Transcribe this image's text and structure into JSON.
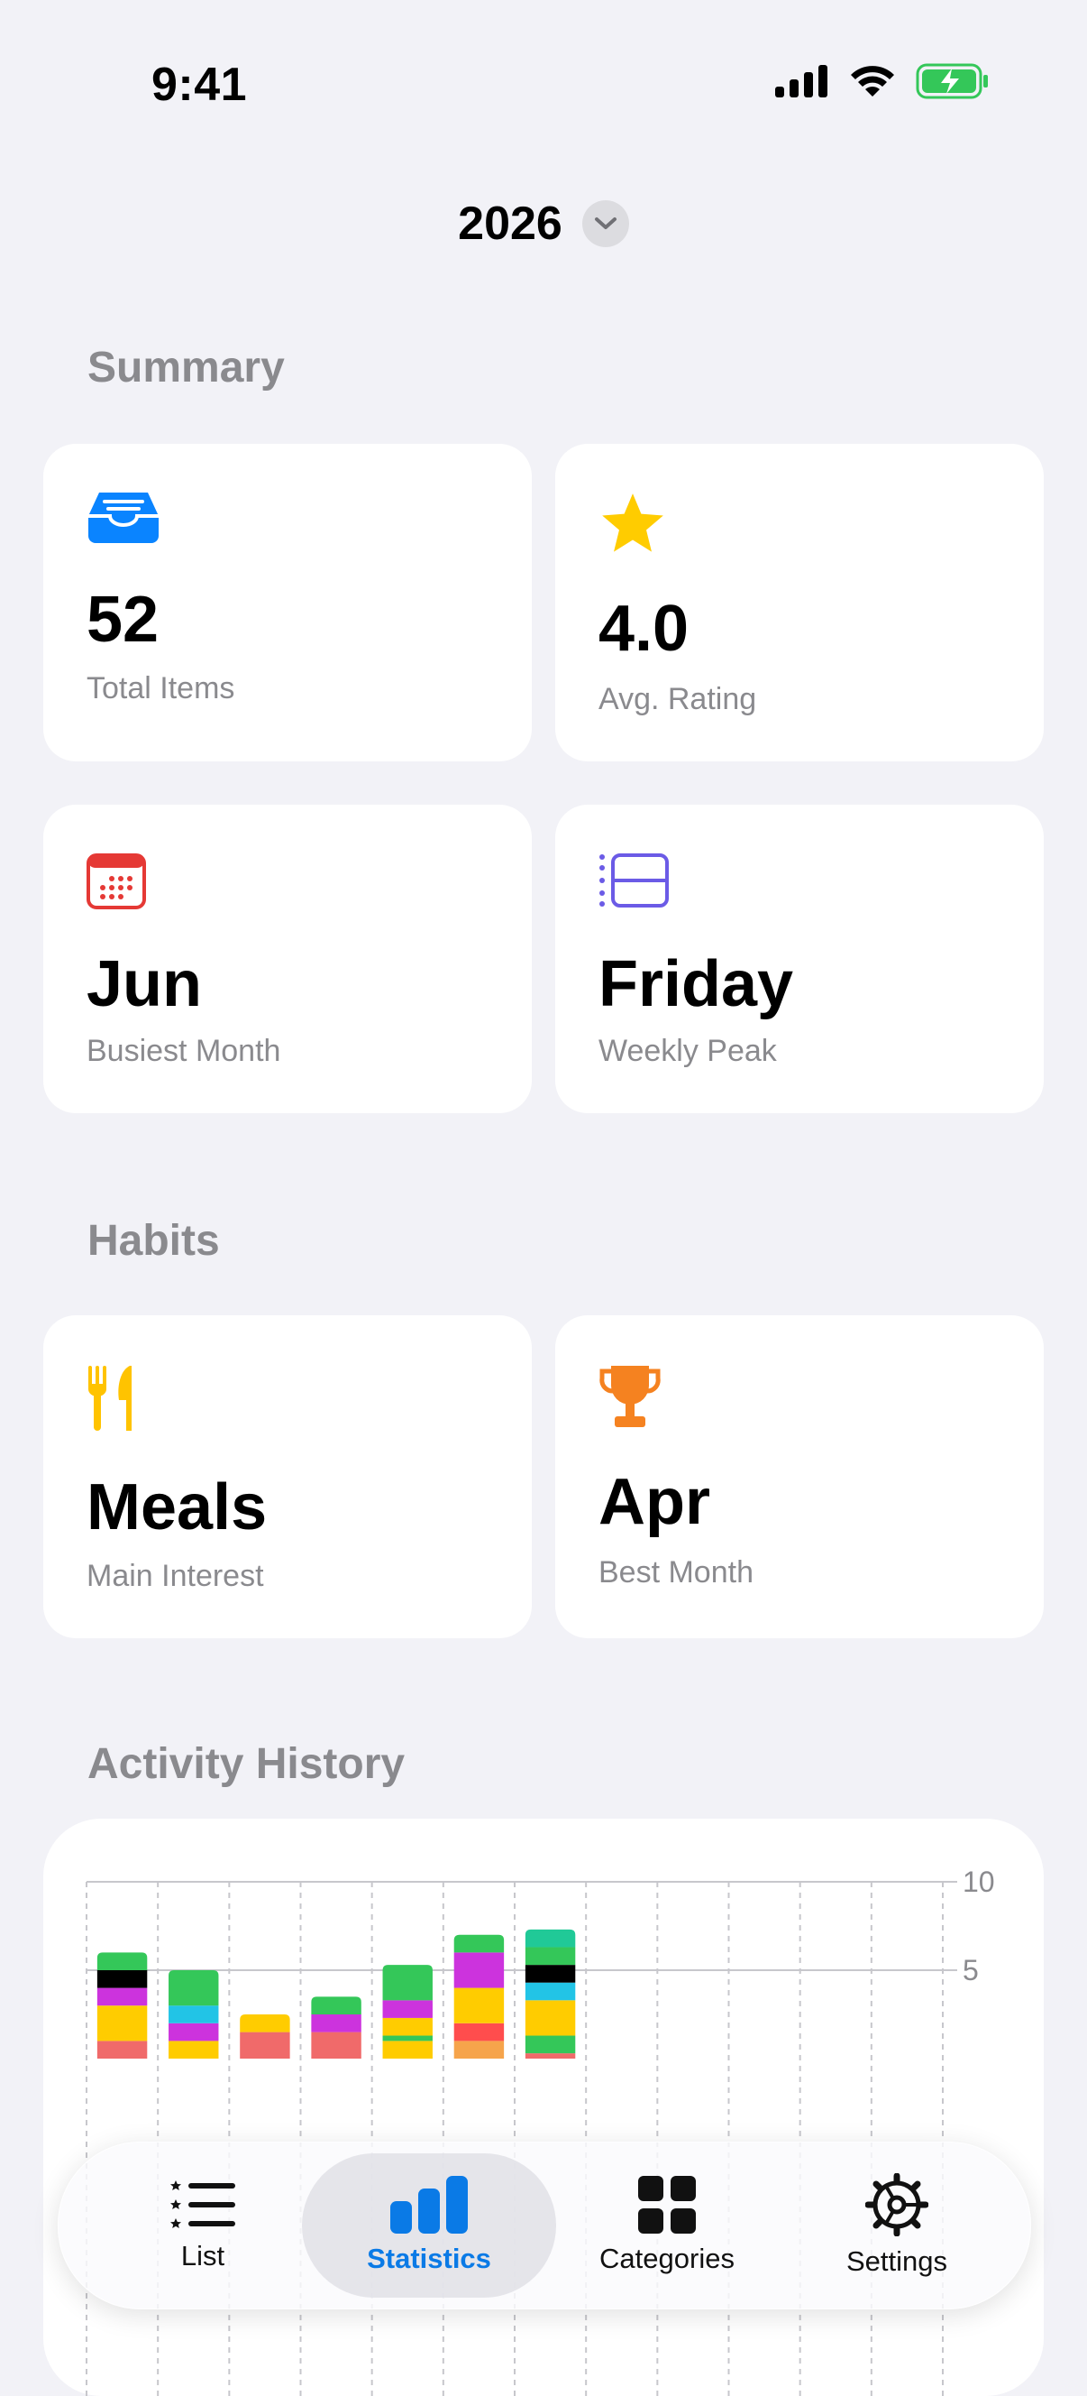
{
  "status_bar": {
    "time": "9:41"
  },
  "year_selector": {
    "year": "2026"
  },
  "summary": {
    "title": "Summary",
    "cards": [
      {
        "icon": "tray-icon",
        "value": "52",
        "label": "Total Items"
      },
      {
        "icon": "star-icon",
        "value": "4.0",
        "label": "Avg. Rating"
      },
      {
        "icon": "calendar-icon",
        "value": "Jun",
        "label": "Busiest Month"
      },
      {
        "icon": "week-timeline-icon",
        "value": "Friday",
        "label": "Weekly Peak"
      }
    ]
  },
  "habits": {
    "title": "Habits",
    "cards": [
      {
        "icon": "fork-knife-icon",
        "value": "Meals",
        "label": "Main Interest"
      },
      {
        "icon": "trophy-icon",
        "value": "Apr",
        "label": "Best Month"
      }
    ]
  },
  "activity": {
    "title": "Activity History"
  },
  "chart_data": {
    "type": "bar",
    "stacked": true,
    "y_ticks": [
      "10",
      "5"
    ],
    "ylim": [
      0,
      10
    ],
    "category_count": 12,
    "stacks": [
      {
        "segments": [
          {
            "value": 1,
            "color": "#F06A6A"
          },
          {
            "value": 2,
            "color": "#FFCC00"
          },
          {
            "value": 1,
            "color": "#CC33DD"
          },
          {
            "value": 1,
            "color": "#000000"
          },
          {
            "value": 1,
            "color": "#34C759"
          }
        ]
      },
      {
        "segments": [
          {
            "value": 1,
            "color": "#FFCC00"
          },
          {
            "value": 1,
            "color": "#CC33DD"
          },
          {
            "value": 1,
            "color": "#22C4E6"
          },
          {
            "value": 2,
            "color": "#34C759"
          }
        ]
      },
      {
        "segments": [
          {
            "value": 1.5,
            "color": "#F06A6A"
          },
          {
            "value": 1,
            "color": "#FFCC00"
          }
        ]
      },
      {
        "segments": [
          {
            "value": 1.5,
            "color": "#F06A6A"
          },
          {
            "value": 1,
            "color": "#CC33DD"
          },
          {
            "value": 1,
            "color": "#34C759"
          }
        ]
      },
      {
        "segments": [
          {
            "value": 1,
            "color": "#FFCC00"
          },
          {
            "value": 0.3,
            "color": "#34C759"
          },
          {
            "value": 1,
            "color": "#FFCC00"
          },
          {
            "value": 1,
            "color": "#CC33DD"
          },
          {
            "value": 2,
            "color": "#34C759"
          }
        ]
      },
      {
        "segments": [
          {
            "value": 1,
            "color": "#F6A44B"
          },
          {
            "value": 1,
            "color": "#FF4D4D"
          },
          {
            "value": 2,
            "color": "#FFCC00"
          },
          {
            "value": 2,
            "color": "#CC33DD"
          },
          {
            "value": 1,
            "color": "#34C759"
          }
        ]
      },
      {
        "segments": [
          {
            "value": 0.3,
            "color": "#F06A6A"
          },
          {
            "value": 1,
            "color": "#34C759"
          },
          {
            "value": 2,
            "color": "#FFCC00"
          },
          {
            "value": 1,
            "color": "#22C4E6"
          },
          {
            "value": 1,
            "color": "#000000"
          },
          {
            "value": 1,
            "color": "#34C759"
          },
          {
            "value": 1,
            "color": "#20C997"
          }
        ]
      }
    ]
  },
  "tabbar": {
    "tabs": [
      {
        "icon": "list-icon",
        "label": "List"
      },
      {
        "icon": "statistics-icon",
        "label": "Statistics",
        "active": true
      },
      {
        "icon": "categories-grid-icon",
        "label": "Categories"
      },
      {
        "icon": "settings-gear-icon",
        "label": "Settings"
      }
    ]
  },
  "colors": {
    "accent": "#0A7AE6",
    "background": "#F2F2F7"
  }
}
